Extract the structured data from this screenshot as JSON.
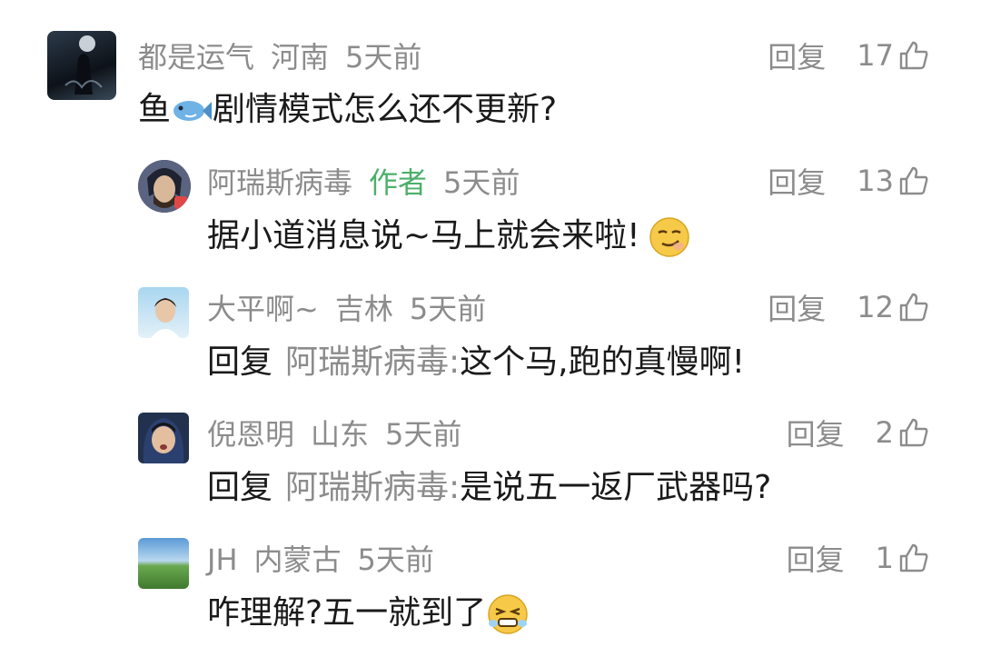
{
  "comments": [
    {
      "username": "都是运气",
      "location": "河南",
      "time": "5天前",
      "reply_label": "回复",
      "likes": "17",
      "text_before": "鱼",
      "text_after": "剧情模式怎么还不更新?",
      "emoji": "fish-emoji"
    },
    {
      "username": "阿瑞斯病毒",
      "author_tag": "作者",
      "time": "5天前",
      "reply_label": "回复",
      "likes": "13",
      "text": "据小道消息说~马上就会来啦!",
      "emoji": "smirk-emoji"
    },
    {
      "username": "大平啊~",
      "location": "吉林",
      "time": "5天前",
      "reply_label": "回复",
      "likes": "12",
      "prefix": "回复",
      "target": "阿瑞斯病毒:",
      "text": "这个马,跑的真慢啊!"
    },
    {
      "username": "倪恩明",
      "location": "山东",
      "time": "5天前",
      "reply_label": "回复",
      "likes": "2",
      "prefix": "回复",
      "target": "阿瑞斯病毒:",
      "text": "是说五一返厂武器吗?"
    },
    {
      "username": "JH",
      "location": "内蒙古",
      "time": "5天前",
      "reply_label": "回复",
      "likes": "1",
      "text": "咋理解?五一就到了",
      "emoji": "grimace-emoji"
    }
  ],
  "colors": {
    "meta": "#8c8c8c",
    "author_tag": "#4caf6a",
    "text": "#1a1a1a"
  },
  "icons": [
    "thumbs-up-icon"
  ]
}
